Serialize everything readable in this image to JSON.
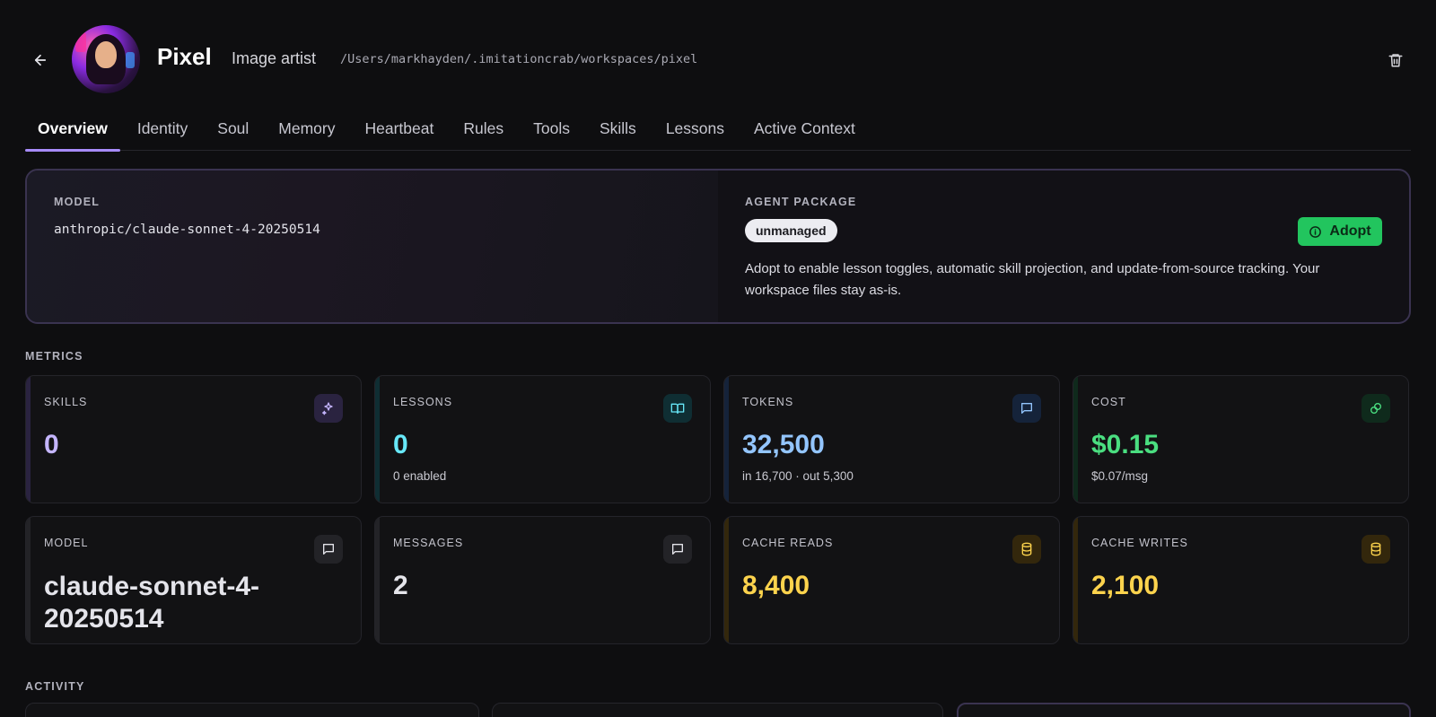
{
  "header": {
    "name": "Pixel",
    "role": "Image artist",
    "path": "/Users/markhayden/.imitationcrab/workspaces/pixel"
  },
  "tabs": [
    {
      "label": "Overview",
      "active": true
    },
    {
      "label": "Identity"
    },
    {
      "label": "Soul"
    },
    {
      "label": "Memory"
    },
    {
      "label": "Heartbeat"
    },
    {
      "label": "Rules"
    },
    {
      "label": "Tools"
    },
    {
      "label": "Skills"
    },
    {
      "label": "Lessons"
    },
    {
      "label": "Active Context"
    }
  ],
  "model_section": {
    "label": "MODEL",
    "value": "anthropic/claude-sonnet-4-20250514"
  },
  "package_section": {
    "label": "AGENT PACKAGE",
    "status": "unmanaged",
    "adopt_label": "Adopt",
    "description": "Adopt to enable lesson toggles, automatic skill projection, and update-from-source tracking. Your workspace files stay as-is."
  },
  "metrics": {
    "label": "METRICS",
    "cards": [
      {
        "label": "SKILLS",
        "value": "0",
        "sub": "",
        "icon": "sparkles-icon",
        "color": "#c4b5fd",
        "accent": "#2a2340"
      },
      {
        "label": "LESSONS",
        "value": "0",
        "sub": "0 enabled",
        "icon": "book-icon",
        "color": "#67e8f9",
        "accent": "#0f2e33"
      },
      {
        "label": "TOKENS",
        "value": "32,500",
        "sub": "in 16,700 · out 5,300",
        "icon": "message-icon",
        "color": "#93c5fd",
        "accent": "#15233a"
      },
      {
        "label": "COST",
        "value": "$0.15",
        "sub": "$0.07/msg",
        "icon": "coins-icon",
        "color": "#4ade80",
        "accent": "#0f2a1c"
      },
      {
        "label": "MODEL",
        "value": "claude-sonnet-4-20250514",
        "sub": "",
        "icon": "message-icon",
        "color": "#e4e4ea",
        "accent": "#232327"
      },
      {
        "label": "MESSAGES",
        "value": "2",
        "sub": "",
        "icon": "message-icon",
        "color": "#e4e4ea",
        "accent": "#232327"
      },
      {
        "label": "CACHE READS",
        "value": "8,400",
        "sub": "",
        "icon": "database-icon",
        "color": "#fcd34d",
        "accent": "#33270c"
      },
      {
        "label": "CACHE WRITES",
        "value": "2,100",
        "sub": "",
        "icon": "database-icon",
        "color": "#fcd34d",
        "accent": "#33270c"
      }
    ]
  },
  "activity": {
    "label": "ACTIVITY"
  }
}
